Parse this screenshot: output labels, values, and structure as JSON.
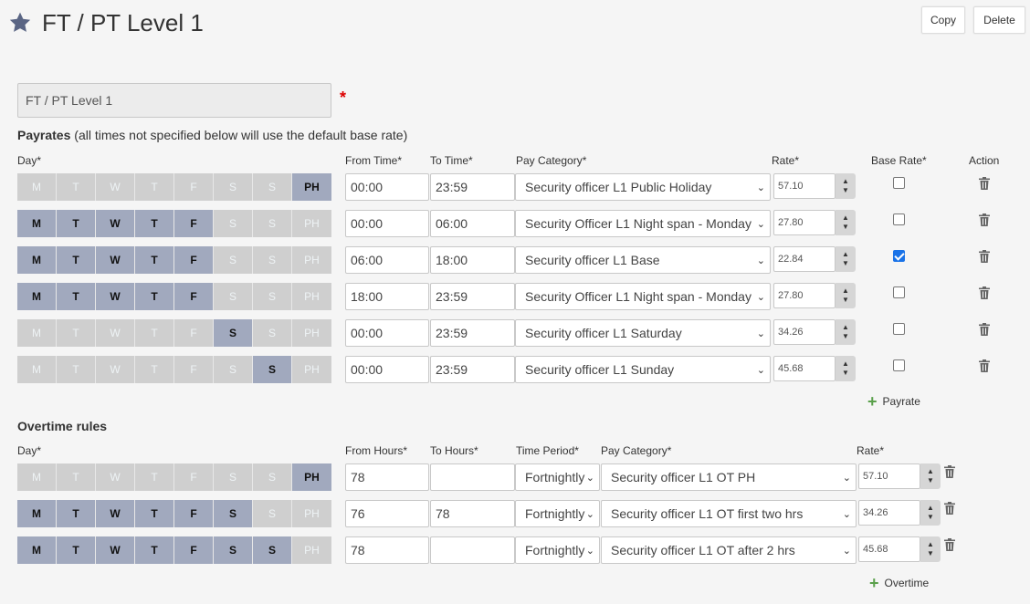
{
  "header": {
    "title": "FT / PT Level 1",
    "copy_label": "Copy",
    "delete_label": "Delete"
  },
  "name_field": {
    "value": "FT / PT Level 1"
  },
  "payrates": {
    "title": "Payrates",
    "subtitle": " (all times not specified below will use the default base rate)",
    "headers": {
      "day": "Day*",
      "from": "From Time*",
      "to": "To Time*",
      "category": "Pay Category*",
      "rate": "Rate*",
      "base": "Base Rate*",
      "action": "Action"
    },
    "day_labels": [
      "M",
      "T",
      "W",
      "T",
      "F",
      "S",
      "S",
      "PH"
    ],
    "rows": [
      {
        "days": [
          0,
          0,
          0,
          0,
          0,
          0,
          0,
          1
        ],
        "from": "00:00",
        "to": "23:59",
        "category": "Security officer L1 Public Holiday",
        "rate": "57.10",
        "base": false
      },
      {
        "days": [
          1,
          1,
          1,
          1,
          1,
          0,
          0,
          0
        ],
        "from": "00:00",
        "to": "06:00",
        "category": "Security Officer L1 Night span - Monday",
        "rate": "27.80",
        "base": false
      },
      {
        "days": [
          1,
          1,
          1,
          1,
          1,
          0,
          0,
          0
        ],
        "from": "06:00",
        "to": "18:00",
        "category": "Security officer L1 Base",
        "rate": "22.84",
        "base": true
      },
      {
        "days": [
          1,
          1,
          1,
          1,
          1,
          0,
          0,
          0
        ],
        "from": "18:00",
        "to": "23:59",
        "category": "Security Officer L1 Night span - Monday",
        "rate": "27.80",
        "base": false
      },
      {
        "days": [
          0,
          0,
          0,
          0,
          0,
          1,
          0,
          0
        ],
        "from": "00:00",
        "to": "23:59",
        "category": "Security officer L1 Saturday",
        "rate": "34.26",
        "base": false
      },
      {
        "days": [
          0,
          0,
          0,
          0,
          0,
          0,
          1,
          0
        ],
        "from": "00:00",
        "to": "23:59",
        "category": "Security officer L1 Sunday",
        "rate": "45.68",
        "base": false
      }
    ],
    "add_label": "Payrate"
  },
  "overtime": {
    "title": "Overtime rules",
    "headers": {
      "day": "Day*",
      "from": "From Hours*",
      "to": "To Hours*",
      "period": "Time Period*",
      "category": "Pay Category*",
      "rate": "Rate*"
    },
    "rows": [
      {
        "days": [
          0,
          0,
          0,
          0,
          0,
          0,
          0,
          1
        ],
        "from": "78",
        "to": "",
        "period": "Fortnightly",
        "category": "Security officer L1 OT PH",
        "rate": "57.10"
      },
      {
        "days": [
          1,
          1,
          1,
          1,
          1,
          1,
          0,
          0
        ],
        "from": "76",
        "to": "78",
        "period": "Fortnightly",
        "category": "Security officer L1 OT first two hrs",
        "rate": "34.26"
      },
      {
        "days": [
          1,
          1,
          1,
          1,
          1,
          1,
          1,
          0
        ],
        "from": "78",
        "to": "",
        "period": "Fortnightly",
        "category": "Security officer L1 OT after 2 hrs",
        "rate": "45.68"
      }
    ],
    "add_label": "Overtime"
  },
  "colors": {
    "day_on": "#a1a9be",
    "day_off": "#cfcfcf",
    "accent_green": "#5aa04b",
    "required": "#dd0000"
  }
}
